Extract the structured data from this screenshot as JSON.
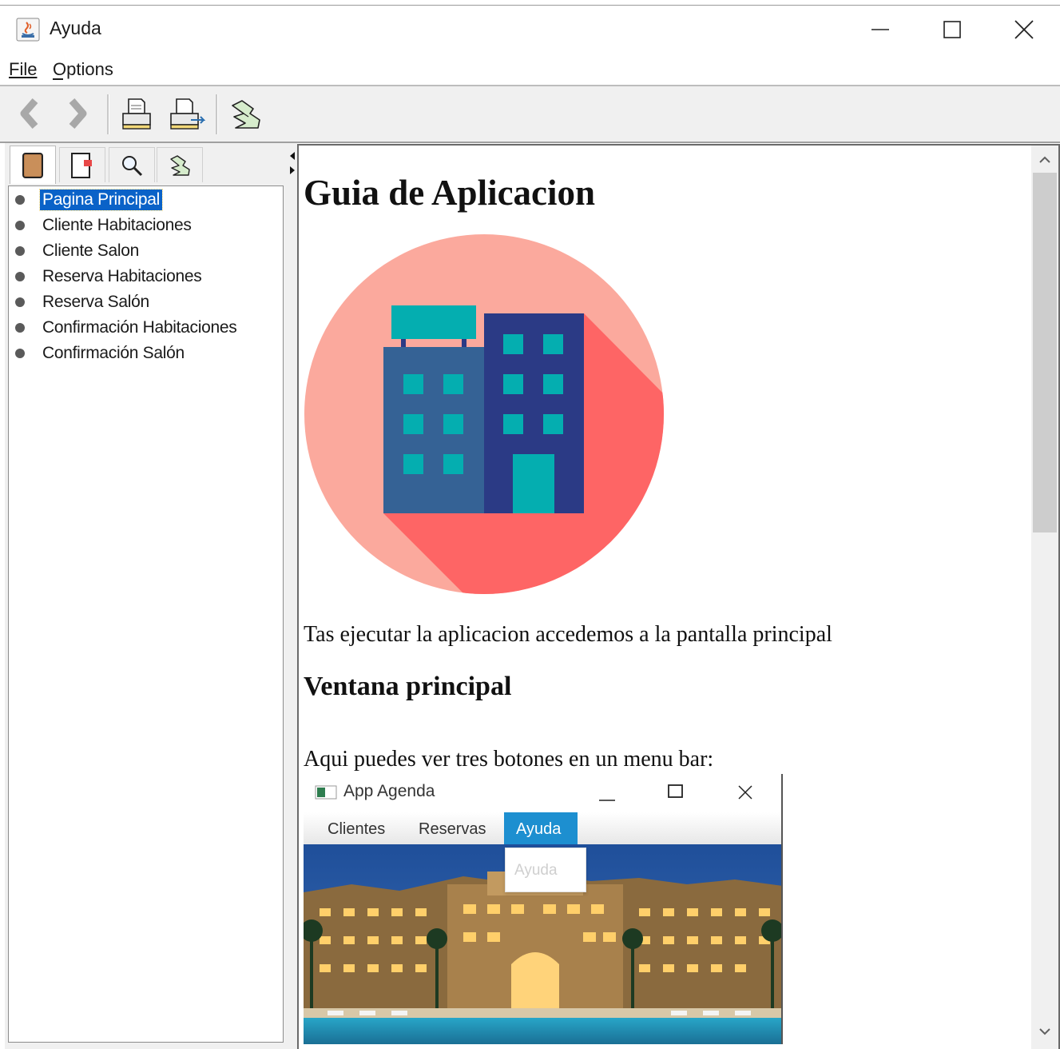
{
  "window": {
    "title": "Ayuda",
    "controls": [
      "minimize",
      "maximize",
      "close"
    ]
  },
  "menubar": {
    "items": [
      {
        "label": "File",
        "mnemonic": "F"
      },
      {
        "label": "Options",
        "mnemonic": "O"
      }
    ]
  },
  "toolbar": {
    "buttons": [
      {
        "icon": "back-arrow-icon",
        "enabled": false
      },
      {
        "icon": "forward-arrow-icon",
        "enabled": false
      },
      {
        "icon": "print-icon"
      },
      {
        "icon": "page-setup-icon"
      },
      {
        "icon": "ok-hand-icon"
      }
    ]
  },
  "nav": {
    "tabs": [
      {
        "icon": "book-icon",
        "active": true
      },
      {
        "icon": "index-icon"
      },
      {
        "icon": "search-icon"
      },
      {
        "icon": "favorites-icon"
      }
    ],
    "tree": [
      {
        "label": "Pagina Principal",
        "selected": true
      },
      {
        "label": "Cliente Habitaciones"
      },
      {
        "label": "Cliente Salon"
      },
      {
        "label": "Reserva Habitaciones"
      },
      {
        "label": "Reserva Salón"
      },
      {
        "label": "Confirmación Habitaciones"
      },
      {
        "label": "Confirmación Salón"
      }
    ]
  },
  "content": {
    "heading": "Guia de Aplicacion",
    "image": "hotel-building-icon",
    "intro": "Tas ejecutar la aplicacion accedemos a la pantalla principal",
    "subheading": "Ventana principal",
    "menu_text": "Aqui puedes ver tres botones en un menu bar:",
    "app_screenshot": {
      "title": "App Agenda",
      "menus": [
        "Clientes",
        "Reservas",
        "Ayuda"
      ],
      "dropdown_item": "Ayuda"
    }
  },
  "colors": {
    "selection": "#0a62c8",
    "circle_light": "#fba99d",
    "circle_shadow": "#fe6565",
    "building_blue": "#356295",
    "building_navy": "#2b3a85",
    "teal": "#04aeb0",
    "app_menu_active": "#1d8fd0"
  }
}
